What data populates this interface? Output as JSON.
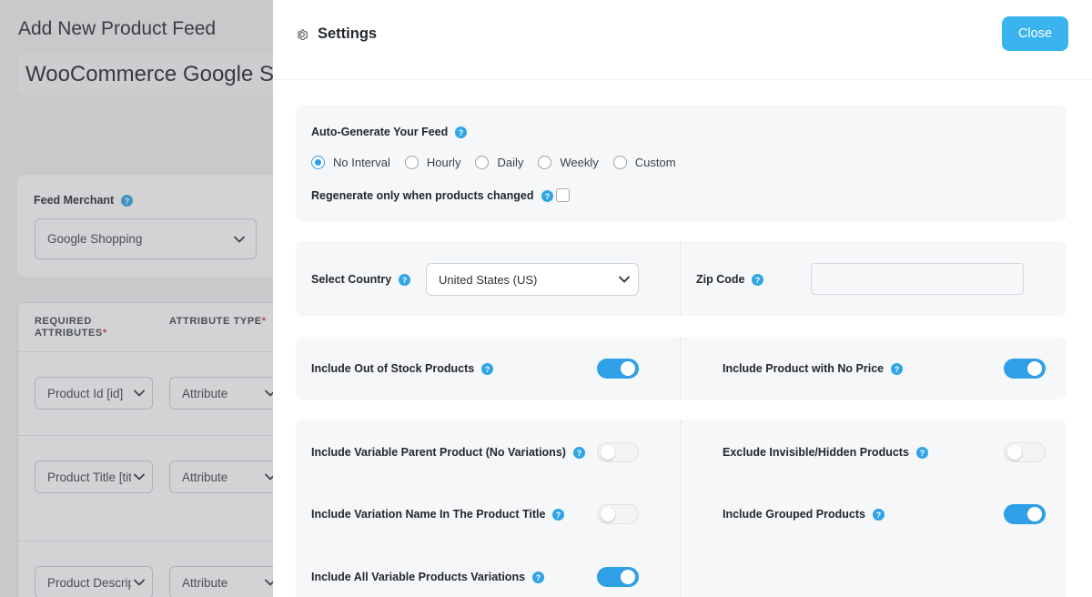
{
  "background": {
    "page_title": "Add New Product Feed",
    "feed_name": "WooCommerce Google Shopping",
    "merchant_label": "Feed Merchant",
    "merchant_value": "Google Shopping",
    "table_headers": {
      "required_line1": "REQUIRED",
      "required_line2": "ATTRIBUTES",
      "required_mark": "*",
      "attr_type": "ATTRIBUTE TYPE",
      "attr_type_mark": "*"
    },
    "rows": [
      {
        "attribute": "Product Id [id]",
        "type": "Attribute"
      },
      {
        "attribute": "Product Title [title]",
        "type": "Attribute"
      },
      {
        "attribute": "Product Description",
        "type": "Attribute"
      }
    ]
  },
  "drawer": {
    "title": "Settings",
    "close_label": "Close",
    "icons": {
      "settings": "gear-icon",
      "help": "question-circle-icon",
      "dropdown": "chevron-down-icon"
    },
    "accent_color": "#39b4ef",
    "auto_generate": {
      "label": "Auto-Generate Your Feed",
      "options": [
        "No Interval",
        "Hourly",
        "Daily",
        "Weekly",
        "Custom"
      ],
      "selected": "No Interval",
      "regenerate_label": "Regenerate only when products changed",
      "regenerate_checked": false
    },
    "country": {
      "label": "Select Country",
      "value": "United States (US)",
      "zip_label": "Zip Code",
      "zip_value": ""
    },
    "toggles_a": {
      "out_of_stock": {
        "label": "Include Out of Stock Products",
        "on": true
      },
      "no_price": {
        "label": "Include Product with No Price",
        "on": true
      }
    },
    "toggles_b": {
      "variable_parent": {
        "label": "Include Variable Parent Product (No Variations)",
        "on": false
      },
      "exclude_hidden": {
        "label": "Exclude Invisible/Hidden Products",
        "on": false
      },
      "variation_name": {
        "label": "Include Variation Name In The Product Title",
        "on": false
      },
      "grouped": {
        "label": "Include Grouped Products",
        "on": true
      },
      "all_variations": {
        "label": "Include All Variable Products Variations",
        "on": true
      }
    }
  }
}
